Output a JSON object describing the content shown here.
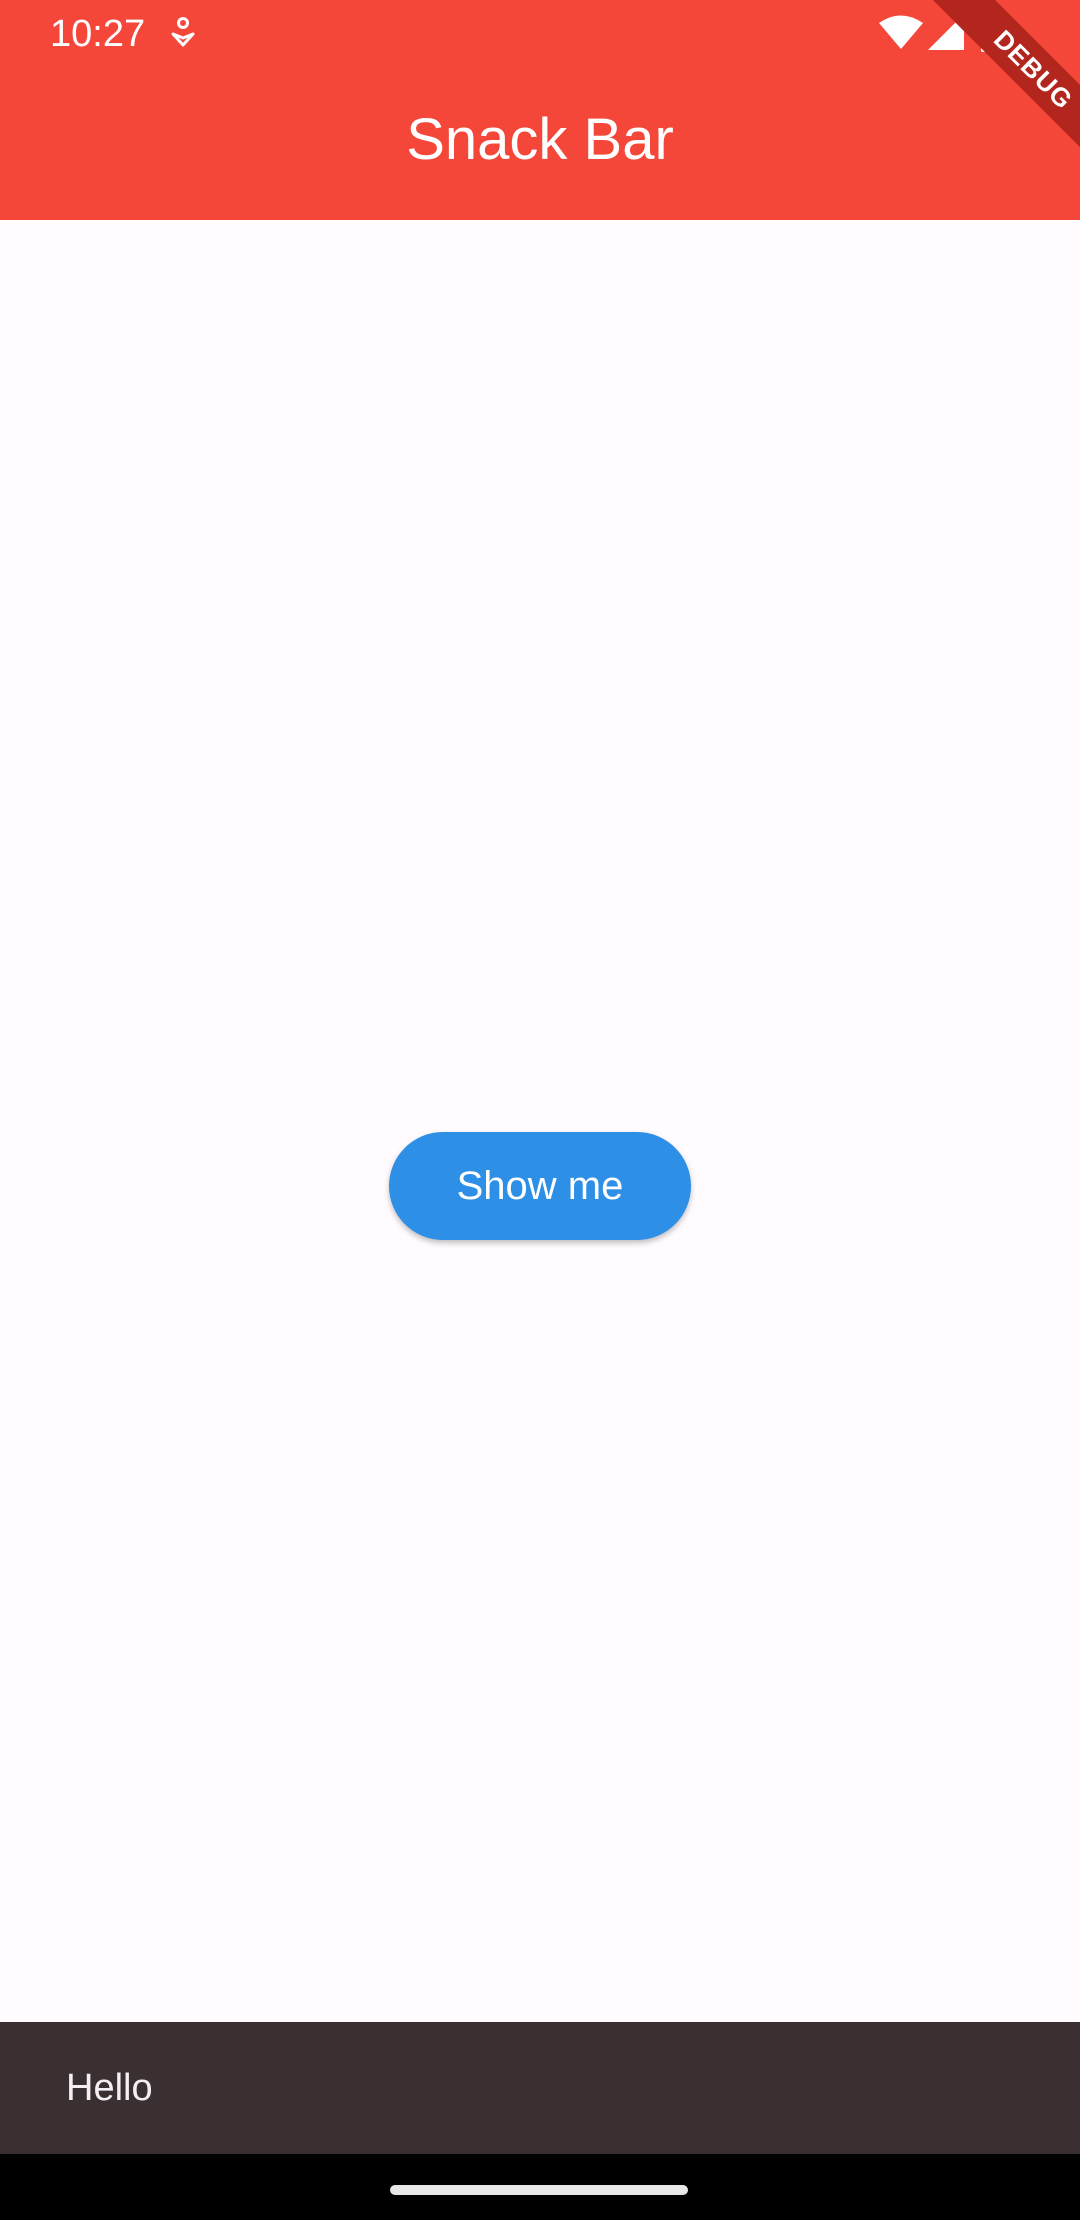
{
  "status_bar": {
    "time": "10:27",
    "icons": [
      "notification-icon",
      "wifi-icon",
      "signal-icon",
      "battery-icon"
    ]
  },
  "app_bar": {
    "title": "Snack Bar",
    "color": "#f44639"
  },
  "debug_banner": {
    "label": "DEBUG"
  },
  "main": {
    "button_label": "Show me",
    "button_color": "#2d8fe6",
    "background": "#fffbfe"
  },
  "snackbar": {
    "message": "Hello",
    "background": "#3a3031"
  }
}
